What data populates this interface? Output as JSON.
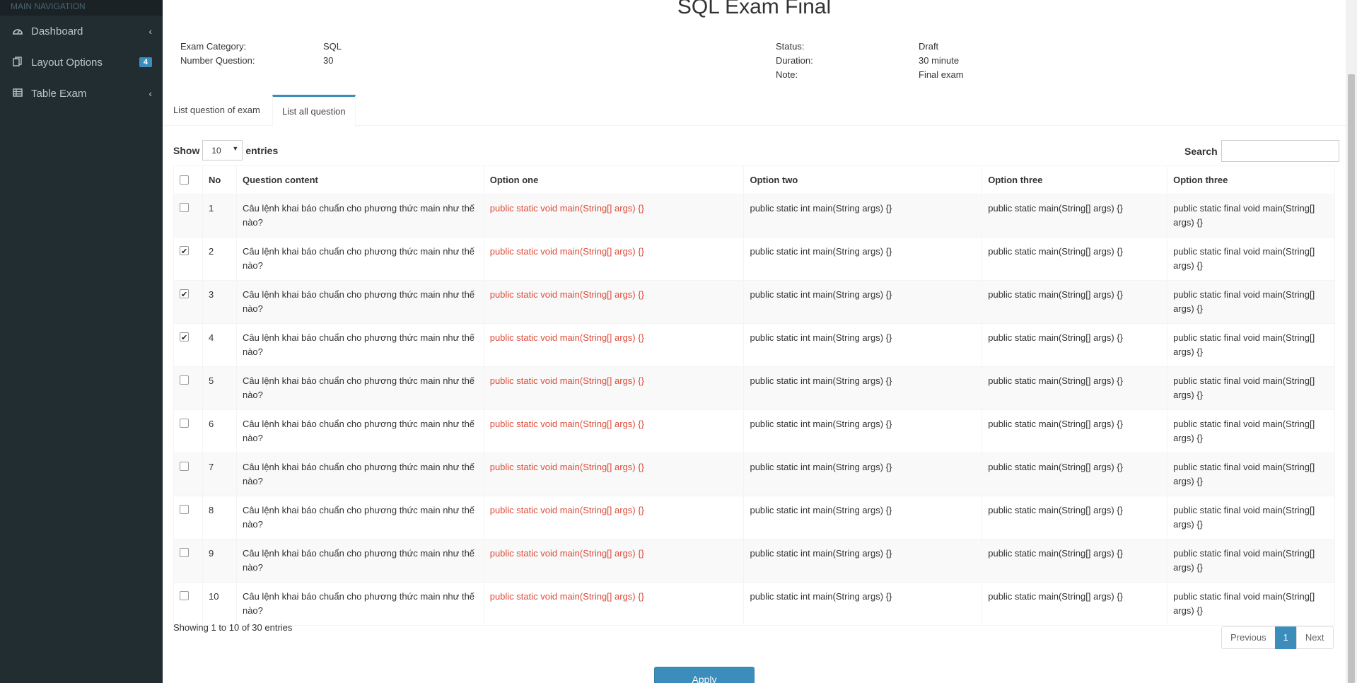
{
  "sidebar": {
    "header": "MAIN NAVIGATION",
    "items": [
      {
        "label": "Dashboard",
        "icon": "dashboard-icon",
        "chevron": "‹"
      },
      {
        "label": "Layout Options",
        "icon": "files-icon",
        "badge": "4"
      },
      {
        "label": "Table Exam",
        "icon": "table-icon",
        "chevron": "‹"
      }
    ]
  },
  "exam": {
    "title": "SQL Exam Final",
    "category_label": "Exam Category:",
    "category_value": "SQL",
    "number_label": "Number Question:",
    "number_value": "30",
    "status_label": "Status:",
    "status_value": "Draft",
    "duration_label": "Duration:",
    "duration_value": "30 minute",
    "note_label": "Note:",
    "note_value": "Final exam"
  },
  "tabs": [
    {
      "label": "List question of exam",
      "active": false
    },
    {
      "label": "List all question",
      "active": true
    }
  ],
  "controls": {
    "show_label": "Show",
    "entries_label": "entries",
    "page_length": "10",
    "search_label": "Search"
  },
  "table": {
    "columns": [
      "",
      "No",
      "Question content",
      "Option one",
      "Option two",
      "Option three",
      "Option three"
    ],
    "rows": [
      {
        "checked": false,
        "no": "1",
        "question": "Câu lệnh khai báo chuẩn cho phương thức main như thế nào?",
        "opt1": "public static void main(String[] args) {}",
        "opt2": "public static int main(String args) {}",
        "opt3": "public static main(String[] args) {}",
        "opt4": "public static final void main(String[] args) {}"
      },
      {
        "checked": true,
        "no": "2",
        "question": "Câu lệnh khai báo chuẩn cho phương thức main như thế nào?",
        "opt1": "public static void main(String[] args) {}",
        "opt2": "public static int main(String args) {}",
        "opt3": "public static main(String[] args) {}",
        "opt4": "public static final void main(String[] args) {}"
      },
      {
        "checked": true,
        "no": "3",
        "question": "Câu lệnh khai báo chuẩn cho phương thức main như thế nào?",
        "opt1": "public static void main(String[] args) {}",
        "opt2": "public static int main(String args) {}",
        "opt3": "public static main(String[] args) {}",
        "opt4": "public static final void main(String[] args) {}"
      },
      {
        "checked": true,
        "no": "4",
        "question": "Câu lệnh khai báo chuẩn cho phương thức main như thế nào?",
        "opt1": "public static void main(String[] args) {}",
        "opt2": "public static int main(String args) {}",
        "opt3": "public static main(String[] args) {}",
        "opt4": "public static final void main(String[] args) {}"
      },
      {
        "checked": false,
        "no": "5",
        "question": "Câu lệnh khai báo chuẩn cho phương thức main như thế nào?",
        "opt1": "public static void main(String[] args) {}",
        "opt2": "public static int main(String args) {}",
        "opt3": "public static main(String[] args) {}",
        "opt4": "public static final void main(String[] args) {}"
      },
      {
        "checked": false,
        "no": "6",
        "question": "Câu lệnh khai báo chuẩn cho phương thức main như thế nào?",
        "opt1": "public static void main(String[] args) {}",
        "opt2": "public static int main(String args) {}",
        "opt3": "public static main(String[] args) {}",
        "opt4": "public static final void main(String[] args) {}"
      },
      {
        "checked": false,
        "no": "7",
        "question": "Câu lệnh khai báo chuẩn cho phương thức main như thế nào?",
        "opt1": "public static void main(String[] args) {}",
        "opt2": "public static int main(String args) {}",
        "opt3": "public static main(String[] args) {}",
        "opt4": "public static final void main(String[] args) {}"
      },
      {
        "checked": false,
        "no": "8",
        "question": "Câu lệnh khai báo chuẩn cho phương thức main như thế nào?",
        "opt1": "public static void main(String[] args) {}",
        "opt2": "public static int main(String args) {}",
        "opt3": "public static main(String[] args) {}",
        "opt4": "public static final void main(String[] args) {}"
      },
      {
        "checked": false,
        "no": "9",
        "question": "Câu lệnh khai báo chuẩn cho phương thức main như thế nào?",
        "opt1": "public static void main(String[] args) {}",
        "opt2": "public static int main(String args) {}",
        "opt3": "public static main(String[] args) {}",
        "opt4": "public static final void main(String[] args) {}"
      },
      {
        "checked": false,
        "no": "10",
        "question": "Câu lệnh khai báo chuẩn cho phương thức main như thế nào?",
        "opt1": "public static void main(String[] args) {}",
        "opt2": "public static int main(String args) {}",
        "opt3": "public static main(String[] args) {}",
        "opt4": "public static final void main(String[] args) {}"
      }
    ]
  },
  "footer": {
    "info": "Showing 1 to 10 of 30 entries",
    "prev": "Previous",
    "page": "1",
    "next": "Next",
    "apply": "Apply"
  },
  "colors": {
    "sidebar_bg": "#222d32",
    "accent": "#3c8dbc",
    "option_one_text": "#dd4b39"
  }
}
